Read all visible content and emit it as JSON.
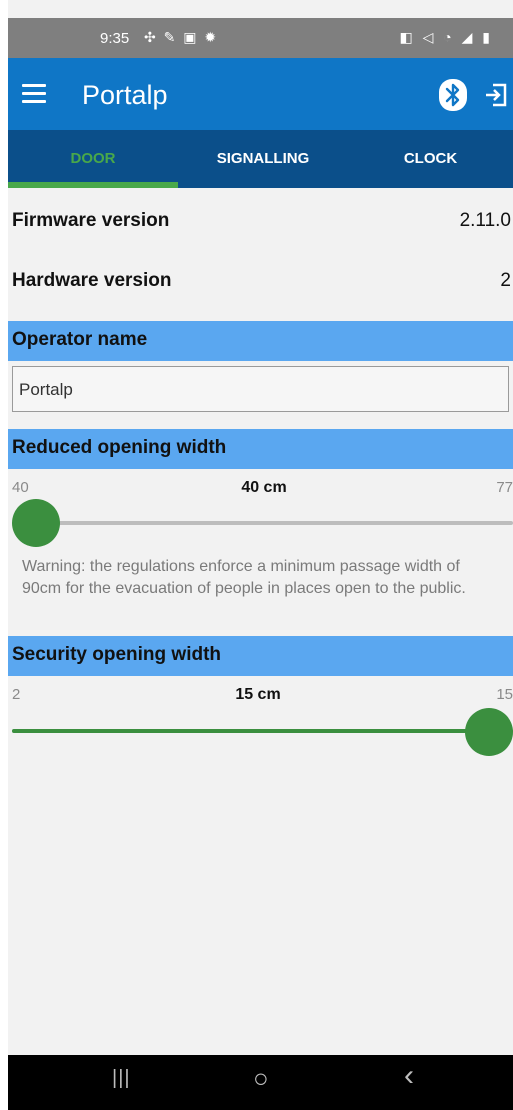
{
  "status": {
    "time": "9:35",
    "left_icons": "✣ ✎ ▣ ✹",
    "right_icons": "◧ ◁ ◔ ◢ ▮"
  },
  "appbar": {
    "title": "Portalp",
    "menu_icon": "menu-icon",
    "bluetooth_icon": "bluetooth-icon",
    "exit_icon": "exit-icon"
  },
  "tabs": [
    {
      "label": "DOOR",
      "active": true
    },
    {
      "label": "SIGNALLING",
      "active": false
    },
    {
      "label": "CLOCK",
      "active": false
    }
  ],
  "info": {
    "firmware_label": "Firmware version",
    "firmware_value": "2.11.0",
    "hardware_label": "Hardware version",
    "hardware_value": "2"
  },
  "operator": {
    "header": "Operator name",
    "value": "Portalp"
  },
  "reduced_width": {
    "header": "Reduced opening width",
    "min": "40",
    "current": "40 cm",
    "max": "77",
    "level": 0.0,
    "warning": "Warning: the regulations enforce a minimum passage width of 90cm for the evacuation of people in places open to the public."
  },
  "security_width": {
    "header": "Security opening width",
    "min": "2",
    "current": "15 cm",
    "max": "15",
    "level": 1.0
  },
  "navbar": {
    "recent": "|||",
    "home": "○",
    "back": "‹"
  },
  "colors": {
    "appbar": "#0f76c6",
    "tabbar": "#0b4f8a",
    "accent_green": "#49a84a",
    "section_header": "#5aa7f0",
    "slider_thumb": "#3b8f3f"
  }
}
